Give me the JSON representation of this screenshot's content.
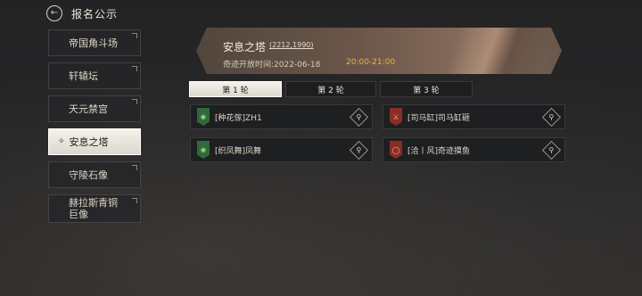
{
  "header": {
    "title": "报名公示",
    "back_icon": "back-arrow-icon"
  },
  "sidebar": {
    "items": [
      {
        "label": "帝国角斗场",
        "active": false
      },
      {
        "label": "轩辕坛",
        "active": false
      },
      {
        "label": "天元禁宫",
        "active": false
      },
      {
        "label": "安息之塔",
        "active": true
      },
      {
        "label": "守陵石像",
        "active": false
      },
      {
        "label": "赫拉斯青铜巨像",
        "active": false
      }
    ]
  },
  "banner": {
    "title": "安息之塔",
    "coord": "(2212,1990)",
    "time_label": "奇迹开放时间:2022-06-18",
    "time_range": "20:00-21:00",
    "accent_color": "#f0b23a"
  },
  "tabs": [
    {
      "label": "第 1 轮",
      "active": true
    },
    {
      "label": "第 2 轮",
      "active": false
    },
    {
      "label": "第 3 轮",
      "active": false
    }
  ],
  "teams": [
    {
      "name": "[种花傢]ZH1",
      "flag": "green"
    },
    {
      "name": "[司马缸]司马缸砸",
      "flag": "red"
    },
    {
      "name": "[织凤舞]凤舞",
      "flag": "green"
    },
    {
      "name": "[洽丨风]奇迹摸鱼",
      "flag": "red"
    }
  ]
}
